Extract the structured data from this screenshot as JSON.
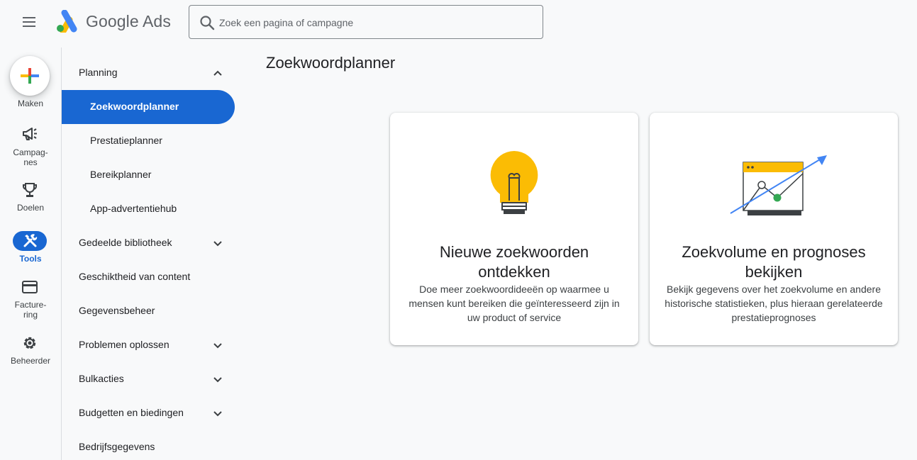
{
  "header": {
    "brand": "Google Ads",
    "search_placeholder": "Zoek een pagina of campagne"
  },
  "rail": {
    "create_label": "Maken",
    "items": [
      {
        "label_line1": "Campag-",
        "label_line2": "nes",
        "icon": "campaigns-megaphone-icon"
      },
      {
        "label_line1": "Doelen",
        "label_line2": "",
        "icon": "goals-trophy-icon"
      },
      {
        "label_line1": "Tools",
        "label_line2": "",
        "icon": "tools-icon",
        "active": true
      },
      {
        "label_line1": "Facture-",
        "label_line2": "ring",
        "icon": "billing-card-icon"
      },
      {
        "label_line1": "Beheerder",
        "label_line2": "",
        "icon": "admin-gear-icon"
      }
    ]
  },
  "nav": {
    "items": [
      {
        "label": "Planning",
        "chevron": "up"
      },
      {
        "label": "Zoekwoordplanner",
        "selected": true
      },
      {
        "label": "Prestatieplanner"
      },
      {
        "label": "Bereikplanner"
      },
      {
        "label": "App-advertentiehub"
      },
      {
        "label": "Gedeelde bibliotheek",
        "chevron": "down"
      },
      {
        "label": "Geschiktheid van content"
      },
      {
        "label": "Gegevensbeheer"
      },
      {
        "label": "Problemen oplossen",
        "chevron": "down"
      },
      {
        "label": "Bulkacties",
        "chevron": "down"
      },
      {
        "label": "Budgetten en biedingen",
        "chevron": "down"
      },
      {
        "label": "Bedrijfsgegevens"
      }
    ]
  },
  "main": {
    "title": "Zoekwoordplanner",
    "cards": [
      {
        "title": "Nieuwe zoekwoorden ontdekken",
        "description": "Doe meer zoekwoordideeën op waarmee u mensen kunt bereiken die geïnteresseerd zijn in uw product of service",
        "icon": "lightbulb-icon"
      },
      {
        "title": "Zoekvolume en prognoses bekijken",
        "description": "Bekijk gegevens over het zoekvolume en andere historische statistieken, plus hieraan gerelateerde prestatieprognoses",
        "icon": "forecast-chart-icon"
      }
    ]
  },
  "colors": {
    "accent": "#1967d2",
    "bulb": "#fbbc04",
    "green": "#34a853",
    "arrow": "#4285f4"
  }
}
